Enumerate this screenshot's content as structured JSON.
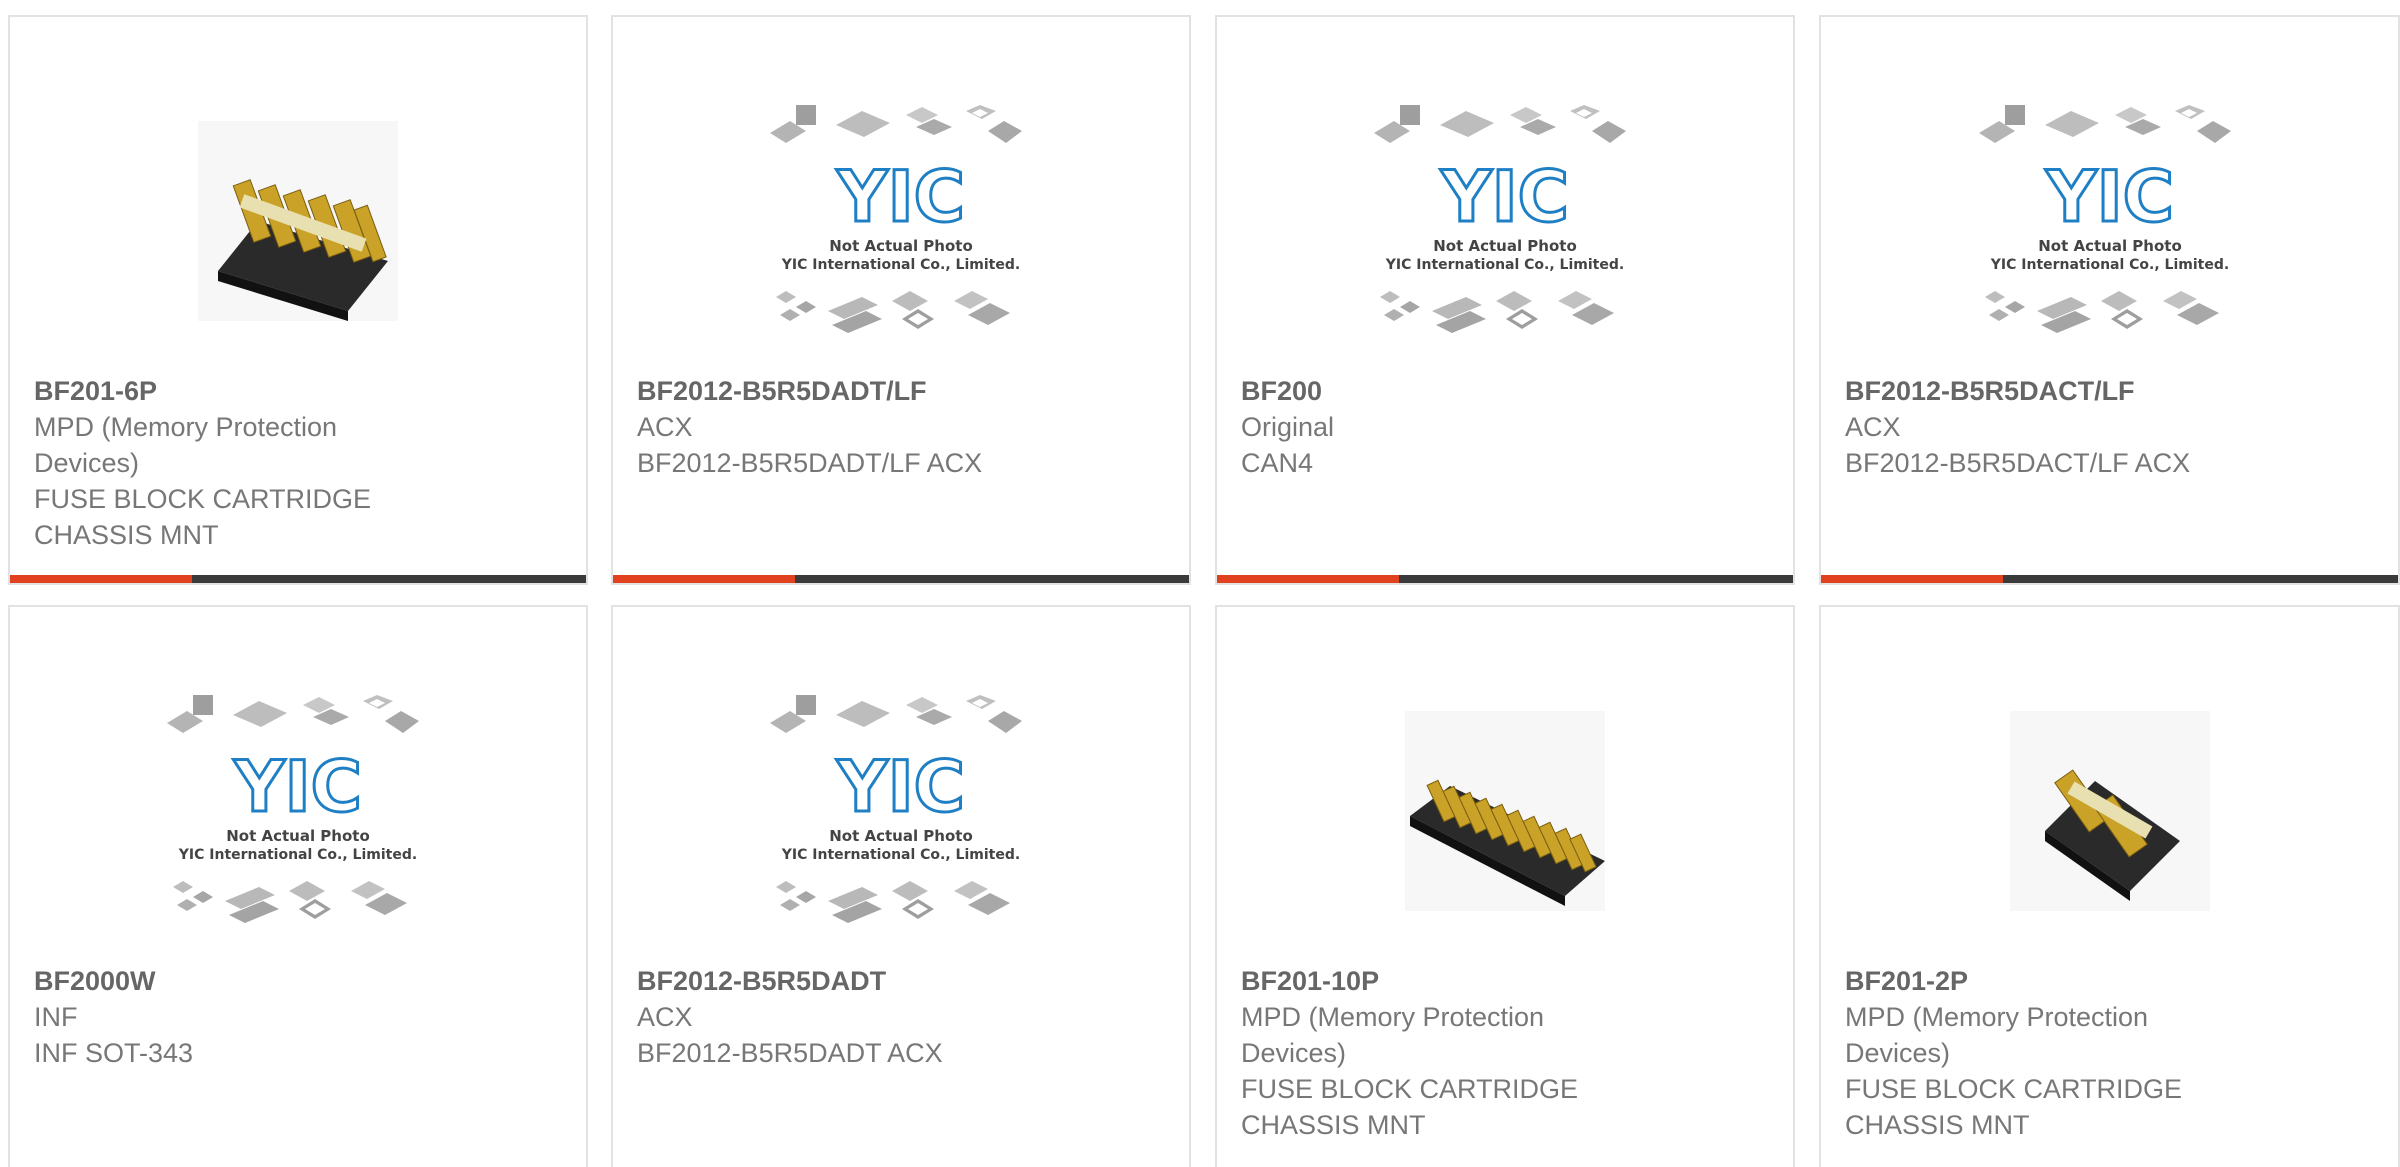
{
  "colors": {
    "accent": "#e0411e",
    "bar": "#3a3a3a",
    "border": "#e2e2e2",
    "text": "#777777",
    "yic_blue": "#1f7fc4"
  },
  "placeholder": {
    "line1": "Not Actual Photo",
    "line2": "YIC International Co., Limited.",
    "logo_text": "YIC"
  },
  "products": [
    {
      "part": "BF201-6P",
      "image": "fuse-block-6p-photo",
      "lines": [
        "MPD (Memory Protection",
        "Devices)",
        "FUSE BLOCK CARTRIDGE",
        "CHASSIS MNT"
      ]
    },
    {
      "part": "BF2012-B5R5DADT/LF",
      "image": "yic-placeholder",
      "lines": [
        "ACX",
        "BF2012-B5R5DADT/LF ACX"
      ]
    },
    {
      "part": "BF200",
      "image": "yic-placeholder",
      "lines": [
        "Original",
        "CAN4"
      ]
    },
    {
      "part": "BF2012-B5R5DACT/LF",
      "image": "yic-placeholder",
      "lines": [
        "ACX",
        "BF2012-B5R5DACT/LF ACX"
      ]
    },
    {
      "part": "BF2000W",
      "image": "yic-placeholder",
      "lines": [
        "INF",
        "INF SOT-343"
      ]
    },
    {
      "part": "BF2012-B5R5DADT",
      "image": "yic-placeholder",
      "lines": [
        "ACX",
        "BF2012-B5R5DADT ACX"
      ]
    },
    {
      "part": "BF201-10P",
      "image": "fuse-block-10p-photo",
      "lines": [
        "MPD (Memory Protection",
        "Devices)",
        "FUSE BLOCK CARTRIDGE",
        "CHASSIS MNT"
      ]
    },
    {
      "part": "BF201-2P",
      "image": "fuse-block-2p-photo",
      "lines": [
        "MPD (Memory Protection",
        "Devices)",
        "FUSE BLOCK CARTRIDGE",
        "CHASSIS MNT"
      ]
    }
  ]
}
